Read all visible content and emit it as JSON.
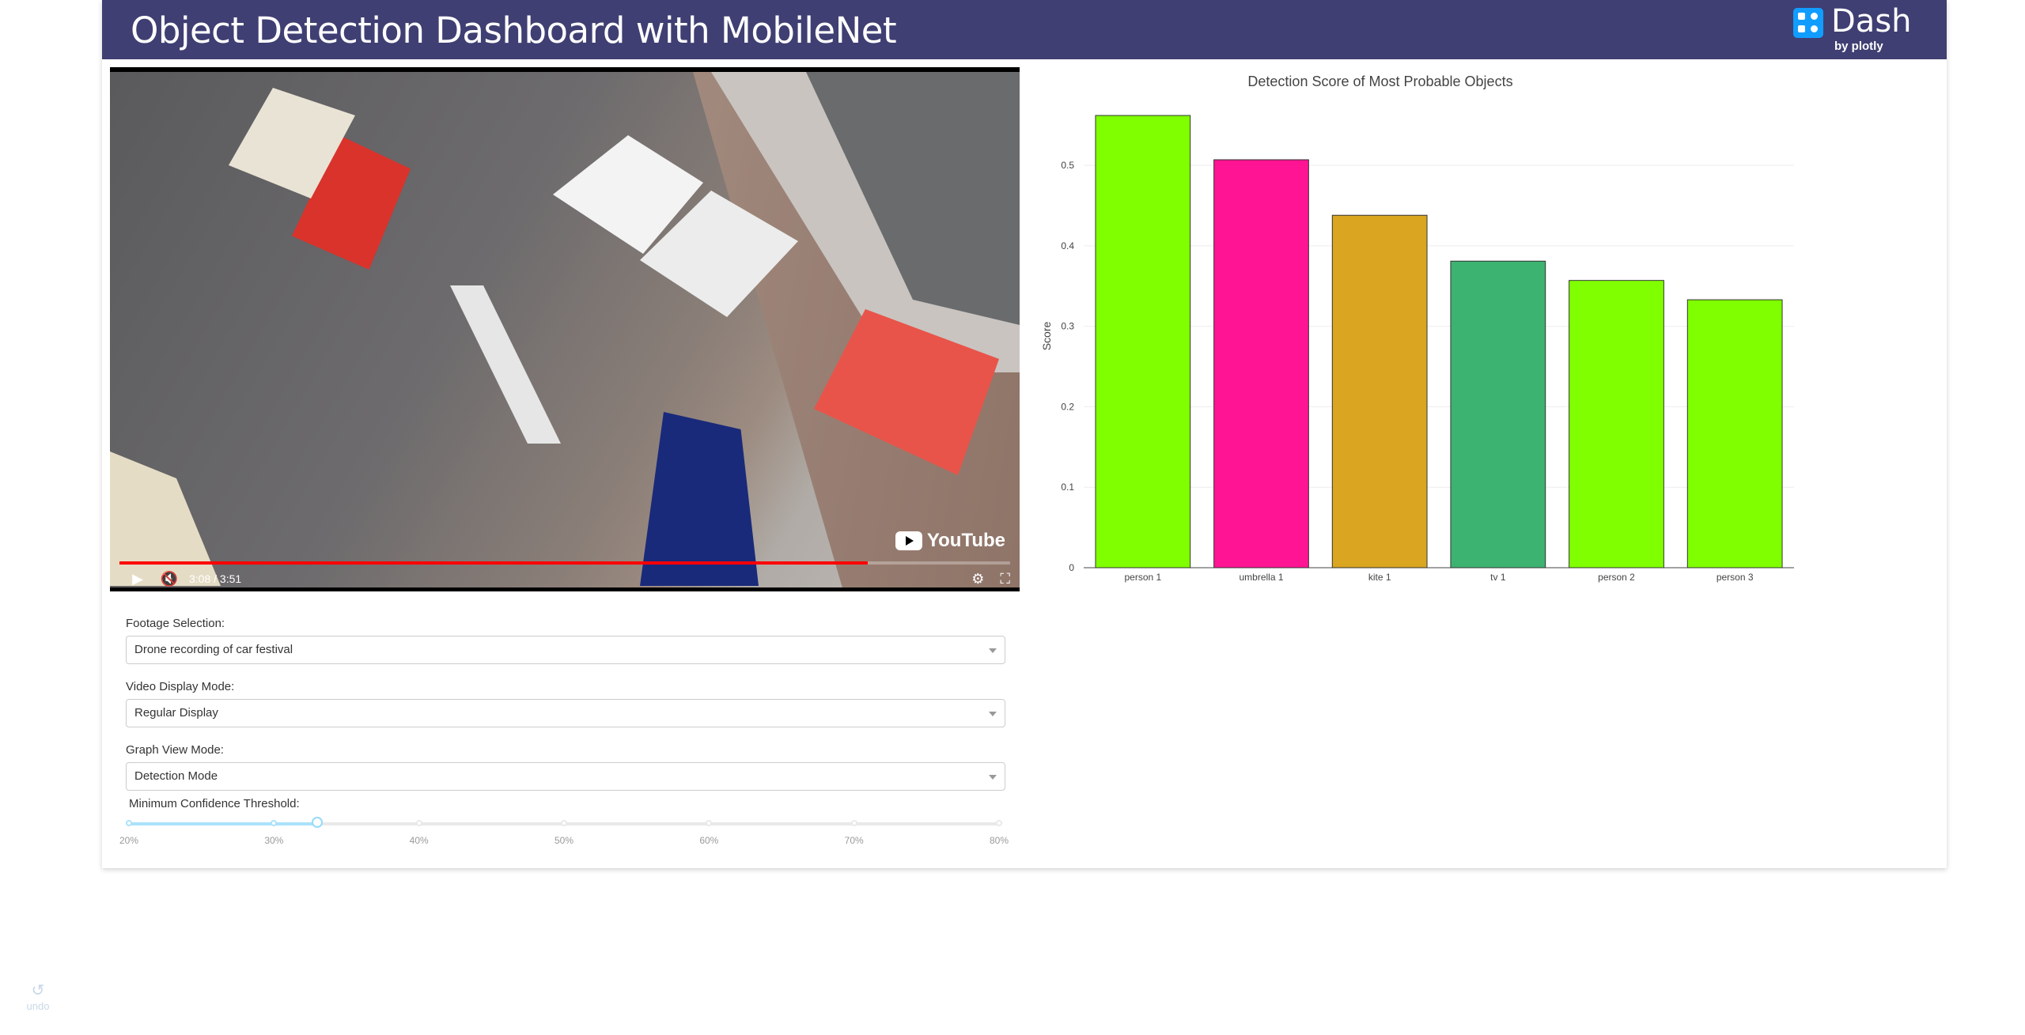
{
  "header": {
    "title": "Object Detection Dashboard with MobileNet",
    "logo_word": "Dash",
    "logo_sub": "by plotly"
  },
  "video": {
    "time": "3:08 / 3:51",
    "progress": 0.84,
    "brand": "YouTube"
  },
  "controls": {
    "footage_label": "Footage Selection:",
    "footage_value": "Drone recording of car festival",
    "display_label": "Video Display Mode:",
    "display_value": "Regular Display",
    "graph_label": "Graph View Mode:",
    "graph_value": "Detection Mode",
    "threshold_label": "Minimum Confidence Threshold:",
    "threshold_value": 0.33,
    "threshold_marks": [
      "20%",
      "30%",
      "40%",
      "50%",
      "60%",
      "70%",
      "80%"
    ]
  },
  "chart_data": {
    "type": "bar",
    "title": "Detection Score of Most Probable Objects",
    "ylabel": "Score",
    "xlabel": "",
    "categories": [
      "person 1",
      "umbrella 1",
      "kite 1",
      "tv 1",
      "person 2",
      "person 3"
    ],
    "values": [
      0.562,
      0.507,
      0.438,
      0.381,
      0.357,
      0.333
    ],
    "colors": [
      "#7fff00",
      "#ff1493",
      "#daa520",
      "#3cb371",
      "#7fff00",
      "#7fff00"
    ],
    "ylim": [
      0,
      0.565
    ],
    "yticks": [
      0,
      0.1,
      0.2,
      0.3,
      0.4,
      0.5
    ],
    "ytick_labels": [
      "0",
      "0.1",
      "0.2",
      "0.3",
      "0.4",
      "0.5"
    ],
    "grid": true
  },
  "undo": {
    "label": "undo"
  }
}
